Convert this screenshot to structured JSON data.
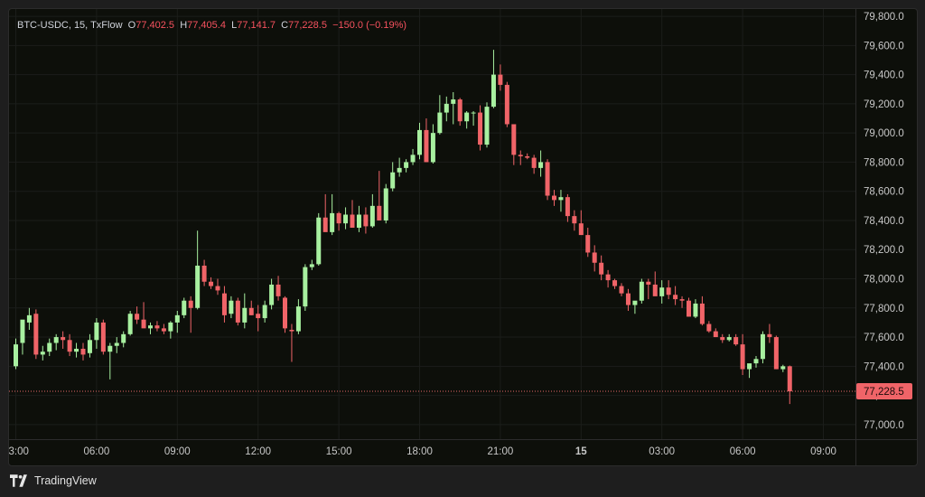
{
  "legend": {
    "symbol": "BTC-USDC, 15, TxFlow",
    "o_label": "O",
    "o_value": "77,402.5",
    "h_label": "H",
    "h_value": "77,405.4",
    "l_label": "L",
    "l_value": "77,141.7",
    "c_label": "C",
    "c_value": "77,228.5",
    "change": "−150.0 (−0.19%)"
  },
  "footer": {
    "brand": "TradingView"
  },
  "colors": {
    "up": "#a8f0a0",
    "down": "#f06468",
    "background": "#0d0f0a",
    "grid": "#1b1d1a",
    "axis_text": "#c8c8c8",
    "price_line": "#e66a6a"
  },
  "chart_data": {
    "type": "candlestick",
    "ylim": [
      76900,
      79850
    ],
    "y_ticks": [
      "77,000.0",
      "77,200.0",
      "77,400.0",
      "77,600.0",
      "77,800.0",
      "78,000.0",
      "78,200.0",
      "78,400.0",
      "78,600.0",
      "78,800.0",
      "79,000.0",
      "79,200.0",
      "79,400.0",
      "79,600.0",
      "79,800.0"
    ],
    "y_tick_values": [
      77000,
      77200,
      77400,
      77600,
      77800,
      78000,
      78200,
      78400,
      78600,
      78800,
      79000,
      79200,
      79400,
      79600,
      79800
    ],
    "x_ticks": [
      "03:00",
      "06:00",
      "09:00",
      "12:00",
      "15:00",
      "18:00",
      "21:00",
      "15",
      "03:00",
      "06:00",
      "09:00"
    ],
    "x_tick_index": [
      0,
      12,
      24,
      36,
      48,
      60,
      72,
      84,
      96,
      108,
      120
    ],
    "last_price": 77228.5,
    "last_price_label": "77,228.5",
    "candles": [
      [
        77400,
        77590,
        77380,
        77550
      ],
      [
        77560,
        77700,
        77480,
        77720
      ],
      [
        77700,
        77800,
        77650,
        77750
      ],
      [
        77760,
        77790,
        77450,
        77480
      ],
      [
        77480,
        77540,
        77440,
        77500
      ],
      [
        77500,
        77590,
        77470,
        77560
      ],
      [
        77560,
        77620,
        77510,
        77600
      ],
      [
        77600,
        77640,
        77520,
        77580
      ],
      [
        77580,
        77620,
        77470,
        77500
      ],
      [
        77500,
        77560,
        77460,
        77520
      ],
      [
        77520,
        77560,
        77440,
        77480
      ],
      [
        77490,
        77620,
        77460,
        77580
      ],
      [
        77580,
        77730,
        77520,
        77700
      ],
      [
        77700,
        77720,
        77480,
        77500
      ],
      [
        77500,
        77560,
        77310,
        77540
      ],
      [
        77540,
        77600,
        77490,
        77560
      ],
      [
        77560,
        77640,
        77530,
        77620
      ],
      [
        77620,
        77780,
        77610,
        77760
      ],
      [
        77760,
        77810,
        77690,
        77720
      ],
      [
        77720,
        77840,
        77670,
        77660
      ],
      [
        77660,
        77700,
        77620,
        77680
      ],
      [
        77680,
        77710,
        77640,
        77660
      ],
      [
        77660,
        77690,
        77620,
        77640
      ],
      [
        77640,
        77710,
        77590,
        77700
      ],
      [
        77700,
        77780,
        77630,
        77750
      ],
      [
        77750,
        77870,
        77730,
        77850
      ],
      [
        77850,
        77880,
        77630,
        77800
      ],
      [
        77800,
        78330,
        77790,
        78090
      ],
      [
        78090,
        78130,
        77950,
        77980
      ],
      [
        77980,
        78010,
        77930,
        77950
      ],
      [
        77950,
        78000,
        77890,
        77920
      ],
      [
        77900,
        77950,
        77700,
        77750
      ],
      [
        77760,
        77880,
        77730,
        77850
      ],
      [
        77850,
        77870,
        77680,
        77700
      ],
      [
        77700,
        77900,
        77660,
        77800
      ],
      [
        77800,
        77850,
        77750,
        77750
      ],
      [
        77760,
        77820,
        77640,
        77730
      ],
      [
        77730,
        77850,
        77700,
        77820
      ],
      [
        77820,
        78000,
        77790,
        77960
      ],
      [
        77960,
        78020,
        77850,
        77880
      ],
      [
        77870,
        77880,
        77630,
        77660
      ],
      [
        77650,
        77690,
        77430,
        77640
      ],
      [
        77640,
        77860,
        77620,
        77810
      ],
      [
        77810,
        78100,
        77780,
        78080
      ],
      [
        78080,
        78130,
        78060,
        78100
      ],
      [
        78100,
        78450,
        78090,
        78420
      ],
      [
        78420,
        78580,
        78400,
        78320
      ],
      [
        78320,
        78580,
        78300,
        78450
      ],
      [
        78450,
        78460,
        78330,
        78380
      ],
      [
        78380,
        78490,
        78340,
        78440
      ],
      [
        78440,
        78540,
        78360,
        78350
      ],
      [
        78350,
        78500,
        78320,
        78440
      ],
      [
        78440,
        78490,
        78310,
        78360
      ],
      [
        78360,
        78580,
        78350,
        78500
      ],
      [
        78500,
        78740,
        78400,
        78400
      ],
      [
        78400,
        78650,
        78380,
        78620
      ],
      [
        78620,
        78800,
        78600,
        78730
      ],
      [
        78730,
        78830,
        78700,
        78760
      ],
      [
        78760,
        78820,
        78730,
        78800
      ],
      [
        78800,
        78890,
        78780,
        78850
      ],
      [
        78850,
        79070,
        78820,
        79020
      ],
      [
        79020,
        79100,
        78800,
        78800
      ],
      [
        78800,
        79060,
        78790,
        79000
      ],
      [
        79000,
        79260,
        78990,
        79140
      ],
      [
        79140,
        79250,
        79080,
        79200
      ],
      [
        79200,
        79280,
        79060,
        79230
      ],
      [
        79230,
        79240,
        79050,
        79080
      ],
      [
        79080,
        79150,
        79030,
        79140
      ],
      [
        79140,
        79150,
        79050,
        79140
      ],
      [
        79140,
        79190,
        78880,
        78920
      ],
      [
        78920,
        79210,
        78900,
        79180
      ],
      [
        79180,
        79570,
        79170,
        79400
      ],
      [
        79400,
        79470,
        79290,
        79330
      ],
      [
        79330,
        79350,
        79040,
        79060
      ],
      [
        79060,
        79050,
        78780,
        78850
      ],
      [
        78850,
        78880,
        78780,
        78840
      ],
      [
        78840,
        78860,
        78820,
        78830
      ],
      [
        78830,
        78850,
        78720,
        78760
      ],
      [
        78760,
        78880,
        78700,
        78800
      ],
      [
        78800,
        78820,
        78540,
        78570
      ],
      [
        78570,
        78610,
        78500,
        78540
      ],
      [
        78540,
        78610,
        78460,
        78560
      ],
      [
        78560,
        78580,
        78390,
        78430
      ],
      [
        78430,
        78470,
        78330,
        78380
      ],
      [
        78380,
        78470,
        78320,
        78300
      ],
      [
        78300,
        78350,
        78150,
        78180
      ],
      [
        78180,
        78230,
        78050,
        78110
      ],
      [
        78110,
        78160,
        77990,
        78030
      ],
      [
        78030,
        78060,
        77940,
        77990
      ],
      [
        77990,
        78000,
        77930,
        77950
      ],
      [
        77950,
        77970,
        77880,
        77900
      ],
      [
        77900,
        77930,
        77780,
        77820
      ],
      [
        77820,
        77820,
        77760,
        77850
      ],
      [
        77850,
        78000,
        77830,
        77980
      ],
      [
        77980,
        78000,
        77860,
        77960
      ],
      [
        77960,
        78050,
        77890,
        77880
      ],
      [
        77880,
        77990,
        77830,
        77940
      ],
      [
        77940,
        77990,
        77860,
        77890
      ],
      [
        77890,
        77950,
        77820,
        77860
      ],
      [
        77860,
        77880,
        77800,
        77850
      ],
      [
        77850,
        77870,
        77740,
        77740
      ],
      [
        77740,
        77860,
        77730,
        77830
      ],
      [
        77830,
        77880,
        77680,
        77690
      ],
      [
        77690,
        77710,
        77630,
        77640
      ],
      [
        77640,
        77660,
        77600,
        77600
      ],
      [
        77600,
        77620,
        77560,
        77580
      ],
      [
        77580,
        77620,
        77570,
        77600
      ],
      [
        77600,
        77620,
        77540,
        77550
      ],
      [
        77550,
        77620,
        77340,
        77380
      ],
      [
        77380,
        77410,
        77320,
        77420
      ],
      [
        77420,
        77470,
        77390,
        77450
      ],
      [
        77450,
        77640,
        77420,
        77620
      ],
      [
        77620,
        77690,
        77560,
        77600
      ],
      [
        77600,
        77610,
        77380,
        77380
      ],
      [
        77380,
        77410,
        77360,
        77400
      ],
      [
        77400,
        77405,
        77141,
        77228
      ]
    ]
  }
}
